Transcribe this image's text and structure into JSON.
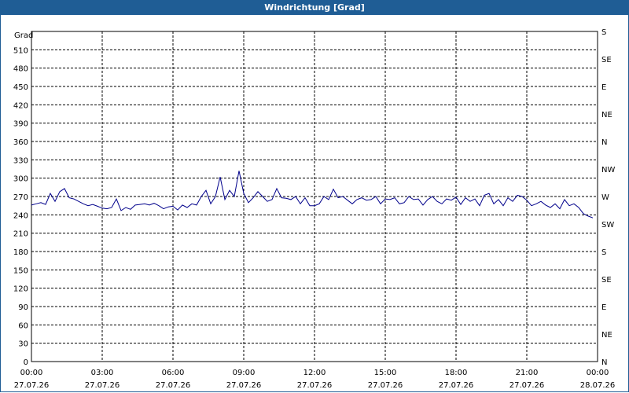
{
  "window": {
    "title": "Windrichtung [Grad]"
  },
  "chart_data": {
    "type": "line",
    "title": "Windrichtung [Grad]",
    "ylabel": "Grad",
    "ylim": [
      0,
      540
    ],
    "yticks": [
      0,
      30,
      60,
      90,
      120,
      150,
      180,
      210,
      240,
      270,
      300,
      330,
      360,
      390,
      420,
      450,
      480,
      510
    ],
    "right_axis_labels": [
      {
        "value": 0,
        "label": "N"
      },
      {
        "value": 45,
        "label": "NE"
      },
      {
        "value": 90,
        "label": "E"
      },
      {
        "value": 135,
        "label": "SE"
      },
      {
        "value": 180,
        "label": "S"
      },
      {
        "value": 225,
        "label": "SW"
      },
      {
        "value": 270,
        "label": "W"
      },
      {
        "value": 315,
        "label": "NW"
      },
      {
        "value": 360,
        "label": "N"
      },
      {
        "value": 405,
        "label": "NE"
      },
      {
        "value": 450,
        "label": "E"
      },
      {
        "value": 495,
        "label": "SE"
      },
      {
        "value": 540,
        "label": "S"
      }
    ],
    "xlim_hours": [
      0,
      24
    ],
    "xticks": [
      {
        "time": "00:00",
        "date": "27.07.26"
      },
      {
        "time": "03:00",
        "date": "27.07.26"
      },
      {
        "time": "06:00",
        "date": "27.07.26"
      },
      {
        "time": "09:00",
        "date": "27.07.26"
      },
      {
        "time": "12:00",
        "date": "27.07.26"
      },
      {
        "time": "15:00",
        "date": "27.07.26"
      },
      {
        "time": "18:00",
        "date": "27.07.26"
      },
      {
        "time": "21:00",
        "date": "27.07.26"
      },
      {
        "time": "00:00",
        "date": "28.07.26"
      }
    ],
    "grid": true,
    "line_color": "#00008b",
    "series": [
      {
        "x_hours": [
          0.0,
          0.2,
          0.4,
          0.6,
          0.8,
          1.0,
          1.2,
          1.4,
          1.6,
          1.8,
          2.0,
          2.2,
          2.4,
          2.6,
          2.8,
          3.0,
          3.2,
          3.4,
          3.6,
          3.8,
          4.0,
          4.2,
          4.4,
          4.6,
          4.8,
          5.0,
          5.2,
          5.4,
          5.6,
          5.8,
          6.0,
          6.2,
          6.4,
          6.6,
          6.8,
          7.0,
          7.2,
          7.4,
          7.6,
          7.8,
          8.0,
          8.2,
          8.4,
          8.6,
          8.8,
          9.0,
          9.2,
          9.4,
          9.6,
          9.8,
          10.0,
          10.2,
          10.4,
          10.6,
          10.8,
          11.0,
          11.2,
          11.4,
          11.6,
          11.8,
          12.0,
          12.2,
          12.4,
          12.6,
          12.8,
          13.0,
          13.2,
          13.4,
          13.6,
          13.8,
          14.0,
          14.2,
          14.4,
          14.6,
          14.8,
          15.0,
          15.2,
          15.4,
          15.6,
          15.8,
          16.0,
          16.2,
          16.4,
          16.6,
          16.8,
          17.0,
          17.2,
          17.4,
          17.6,
          17.8,
          18.0,
          18.2,
          18.4,
          18.6,
          18.8,
          19.0,
          19.2,
          19.4,
          19.6,
          19.8,
          20.0,
          20.2,
          20.4,
          20.6,
          20.8,
          21.0,
          21.2,
          21.4,
          21.6,
          21.8,
          22.0,
          22.2,
          22.4,
          22.6,
          22.8,
          23.0,
          23.2,
          23.4,
          23.6,
          23.8
        ],
        "values": [
          256,
          258,
          260,
          257,
          275,
          262,
          278,
          283,
          268,
          266,
          262,
          258,
          255,
          257,
          254,
          251,
          250,
          252,
          266,
          247,
          252,
          249,
          256,
          257,
          258,
          256,
          259,
          255,
          250,
          253,
          254,
          248,
          256,
          252,
          258,
          256,
          270,
          280,
          258,
          270,
          302,
          265,
          280,
          270,
          312,
          275,
          260,
          268,
          278,
          270,
          262,
          265,
          283,
          268,
          267,
          265,
          270,
          258,
          268,
          255,
          255,
          258,
          270,
          265,
          282,
          268,
          270,
          264,
          258,
          265,
          268,
          264,
          265,
          270,
          258,
          266,
          265,
          268,
          258,
          260,
          270,
          265,
          266,
          256,
          265,
          270,
          262,
          258,
          266,
          264,
          269,
          257,
          268,
          262,
          266,
          255,
          272,
          275,
          258,
          265,
          255,
          268,
          262,
          272,
          270,
          264,
          255,
          258,
          262,
          256,
          252,
          258,
          250,
          265,
          255,
          258,
          252,
          242,
          238,
          235
        ]
      }
    ]
  }
}
